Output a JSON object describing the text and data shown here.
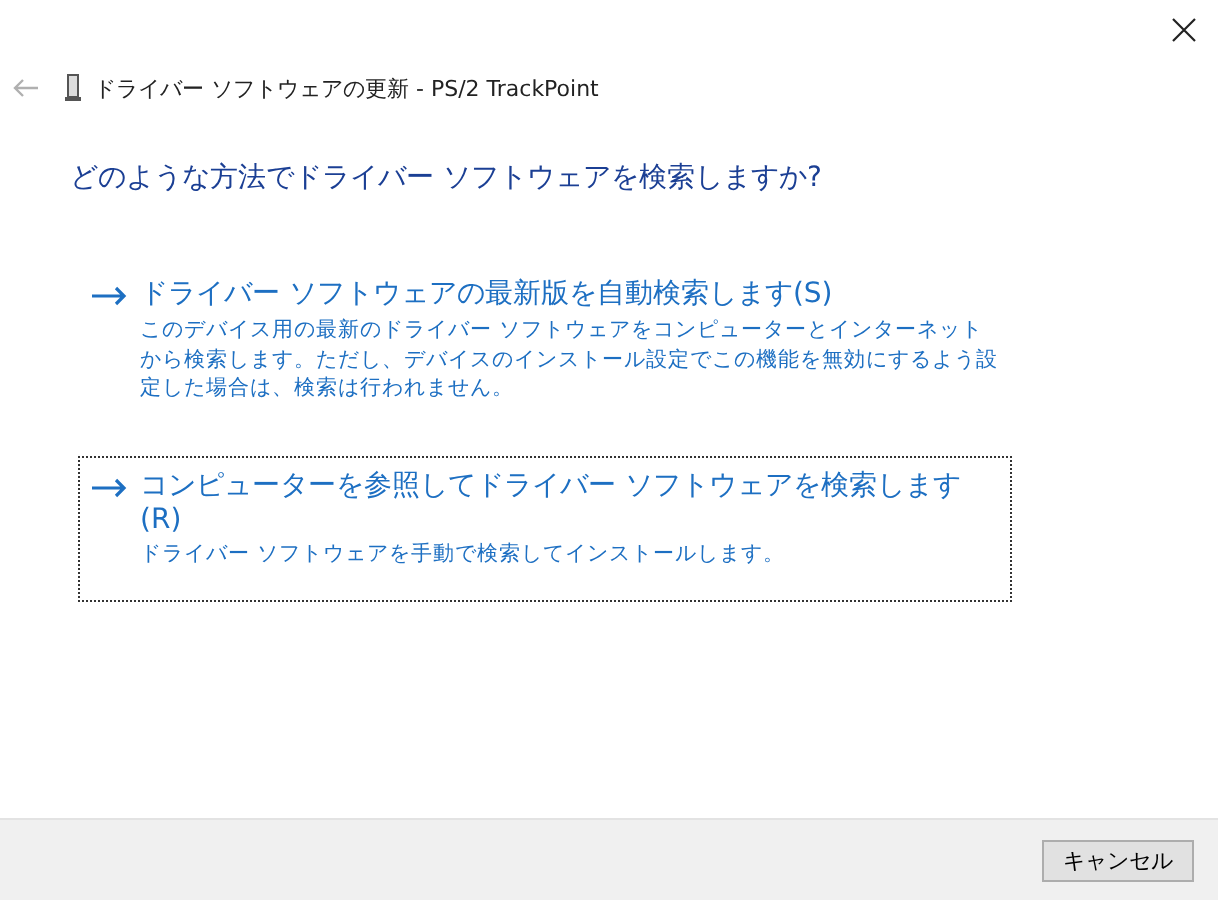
{
  "window": {
    "title": "ドライバー ソフトウェアの更新 - PS/2 TrackPoint"
  },
  "heading": "どのような方法でドライバー ソフトウェアを検索しますか?",
  "options": [
    {
      "title": "ドライバー ソフトウェアの最新版を自動検索します(S)",
      "description": "このデバイス用の最新のドライバー ソフトウェアをコンピューターとインターネットから検索します。ただし、デバイスのインストール設定でこの機能を無効にするよう設定した場合は、検索は行われません。",
      "selected": false
    },
    {
      "title": "コンピューターを参照してドライバー ソフトウェアを検索します(R)",
      "description": "ドライバー ソフトウェアを手動で検索してインストールします。",
      "selected": true
    }
  ],
  "buttons": [
    "キャンセル"
  ]
}
